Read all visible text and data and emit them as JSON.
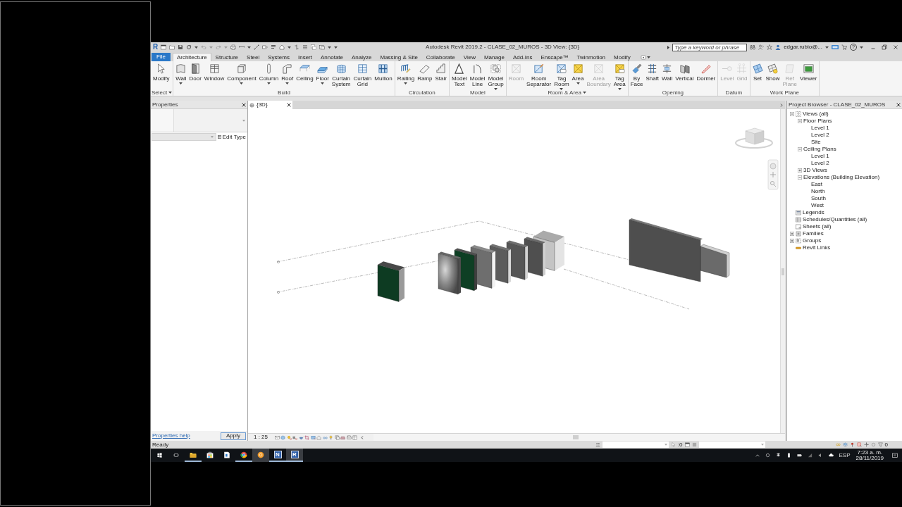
{
  "window": {
    "logo": "R",
    "title": "Autodesk Revit 2019.2 - CLASE_02_MUROS - 3D View: {3D}"
  },
  "title_bar": {
    "search": {
      "placeholder": "Type a keyword or phrase"
    },
    "user": "edgar.rubio@...",
    "help": "?"
  },
  "ribbon": {
    "file_menu": "File",
    "tabs": [
      {
        "label": "Architecture",
        "selected": true
      },
      {
        "label": "Structure",
        "selected": false
      },
      {
        "label": "Steel",
        "selected": false
      },
      {
        "label": "Systems",
        "selected": false
      },
      {
        "label": "Insert",
        "selected": false
      },
      {
        "label": "Annotate",
        "selected": false
      },
      {
        "label": "Analyze",
        "selected": false
      },
      {
        "label": "Massing & Site",
        "selected": false
      },
      {
        "label": "Collaborate",
        "selected": false
      },
      {
        "label": "View",
        "selected": false
      },
      {
        "label": "Manage",
        "selected": false
      },
      {
        "label": "Add-Ins",
        "selected": false
      },
      {
        "label": "Enscape™",
        "selected": false
      },
      {
        "label": "Twinmotion",
        "selected": false
      },
      {
        "label": "Modify",
        "selected": false
      }
    ],
    "panels": [
      {
        "title": "Select",
        "dropdown": true,
        "tools": [
          {
            "label": "Modify",
            "dropdown": false,
            "disabled": false
          }
        ]
      },
      {
        "title": "Build",
        "dropdown": false,
        "tools": [
          {
            "label": "Wall",
            "dropdown": true,
            "disabled": false
          },
          {
            "label": "Door",
            "dropdown": false,
            "disabled": false
          },
          {
            "label": "Window",
            "dropdown": false,
            "disabled": false
          },
          {
            "label": "Component",
            "dropdown": true,
            "disabled": false
          },
          {
            "label": "Column",
            "dropdown": true,
            "disabled": false
          },
          {
            "label": "Roof",
            "dropdown": true,
            "disabled": false
          },
          {
            "label": "Ceiling",
            "dropdown": false,
            "disabled": false
          },
          {
            "label": "Floor",
            "dropdown": true,
            "disabled": false
          },
          {
            "label": "Curtain System",
            "dropdown": false,
            "disabled": false
          },
          {
            "label": "Curtain Grid",
            "dropdown": false,
            "disabled": false
          },
          {
            "label": "Mullion",
            "dropdown": false,
            "disabled": false
          }
        ]
      },
      {
        "title": "Circulation",
        "dropdown": false,
        "tools": [
          {
            "label": "Railing",
            "dropdown": true,
            "disabled": false
          },
          {
            "label": "Ramp",
            "dropdown": false,
            "disabled": false
          },
          {
            "label": "Stair",
            "dropdown": false,
            "disabled": false
          }
        ]
      },
      {
        "title": "Model",
        "dropdown": false,
        "tools": [
          {
            "label": "Model Text",
            "dropdown": false,
            "disabled": false
          },
          {
            "label": "Model Line",
            "dropdown": false,
            "disabled": false
          },
          {
            "label": "Model Group",
            "dropdown": true,
            "disabled": false
          }
        ]
      },
      {
        "title": "Room & Area",
        "dropdown": true,
        "tools": [
          {
            "label": "Room",
            "dropdown": false,
            "disabled": true
          },
          {
            "label": "Room Separator",
            "dropdown": false,
            "disabled": false
          },
          {
            "label": "Tag Room",
            "dropdown": true,
            "disabled": false
          },
          {
            "label": "Area",
            "dropdown": true,
            "disabled": false
          },
          {
            "label": "Area Boundary",
            "dropdown": false,
            "disabled": true
          },
          {
            "label": "Tag Area",
            "dropdown": true,
            "disabled": false
          }
        ]
      },
      {
        "title": "Opening",
        "dropdown": false,
        "tools": [
          {
            "label": "By Face",
            "dropdown": false,
            "disabled": false
          },
          {
            "label": "Shaft",
            "dropdown": false,
            "disabled": false
          },
          {
            "label": "Wall",
            "dropdown": false,
            "disabled": false
          },
          {
            "label": "Vertical",
            "dropdown": false,
            "disabled": false
          },
          {
            "label": "Dormer",
            "dropdown": false,
            "disabled": false
          }
        ]
      },
      {
        "title": "Datum",
        "dropdown": false,
        "tools": [
          {
            "label": "Level",
            "dropdown": false,
            "disabled": true
          },
          {
            "label": "Grid",
            "dropdown": false,
            "disabled": true
          }
        ]
      },
      {
        "title": "Work Plane",
        "dropdown": false,
        "tools": [
          {
            "label": "Set",
            "dropdown": false,
            "disabled": false
          },
          {
            "label": "Show",
            "dropdown": false,
            "disabled": false
          },
          {
            "label": "Ref Plane",
            "dropdown": false,
            "disabled": true
          },
          {
            "label": "Viewer",
            "dropdown": false,
            "disabled": false
          }
        ]
      }
    ]
  },
  "properties": {
    "title": "Properties",
    "edit_type": "Edit Type",
    "help_link": "Properties help",
    "apply": "Apply"
  },
  "view": {
    "tab": "{3D}",
    "scale": "1 : 25"
  },
  "project_browser": {
    "title": "Project Browser - CLASE_02_MUROS",
    "tree": [
      {
        "label": "Views (all)",
        "kind": "views",
        "expanded": true,
        "children": [
          {
            "label": "Floor Plans",
            "expanded": true,
            "children": [
              {
                "label": "Level 1"
              },
              {
                "label": "Level 2"
              },
              {
                "label": "Site"
              }
            ]
          },
          {
            "label": "Ceiling Plans",
            "expanded": true,
            "children": [
              {
                "label": "Level 1"
              },
              {
                "label": "Level 2"
              }
            ]
          },
          {
            "label": "3D Views",
            "expanded": false
          },
          {
            "label": "Elevations (Building Elevation)",
            "expanded": true,
            "children": [
              {
                "label": "East"
              },
              {
                "label": "North"
              },
              {
                "label": "South"
              },
              {
                "label": "West"
              }
            ]
          }
        ]
      },
      {
        "label": "Legends",
        "kind": "legend"
      },
      {
        "label": "Schedules/Quantities (all)",
        "kind": "schedule"
      },
      {
        "label": "Sheets (all)",
        "kind": "sheet"
      },
      {
        "label": "Families",
        "kind": "family",
        "expanded": false
      },
      {
        "label": "Groups",
        "kind": "group",
        "expanded": false
      },
      {
        "label": "Revit Links",
        "kind": "link"
      }
    ]
  },
  "status_bar": {
    "message": "Ready",
    "count": ":0",
    "filter_count": "0"
  },
  "taskbar": {
    "apps": [
      {
        "kind": "explorer",
        "running": true,
        "selected": false
      },
      {
        "kind": "store",
        "running": false,
        "selected": false
      },
      {
        "kind": "document",
        "running": false,
        "selected": false
      },
      {
        "kind": "browser",
        "running": true,
        "selected": false
      },
      {
        "kind": "disc",
        "running": false,
        "selected": true
      },
      {
        "kind": "letter",
        "letter": "N",
        "running": true,
        "selected": false
      },
      {
        "kind": "letter",
        "letter": "R",
        "running": true,
        "selected": true
      }
    ],
    "language": "ESP",
    "time": "7:23 a. m.",
    "date": "28/11/2019"
  }
}
